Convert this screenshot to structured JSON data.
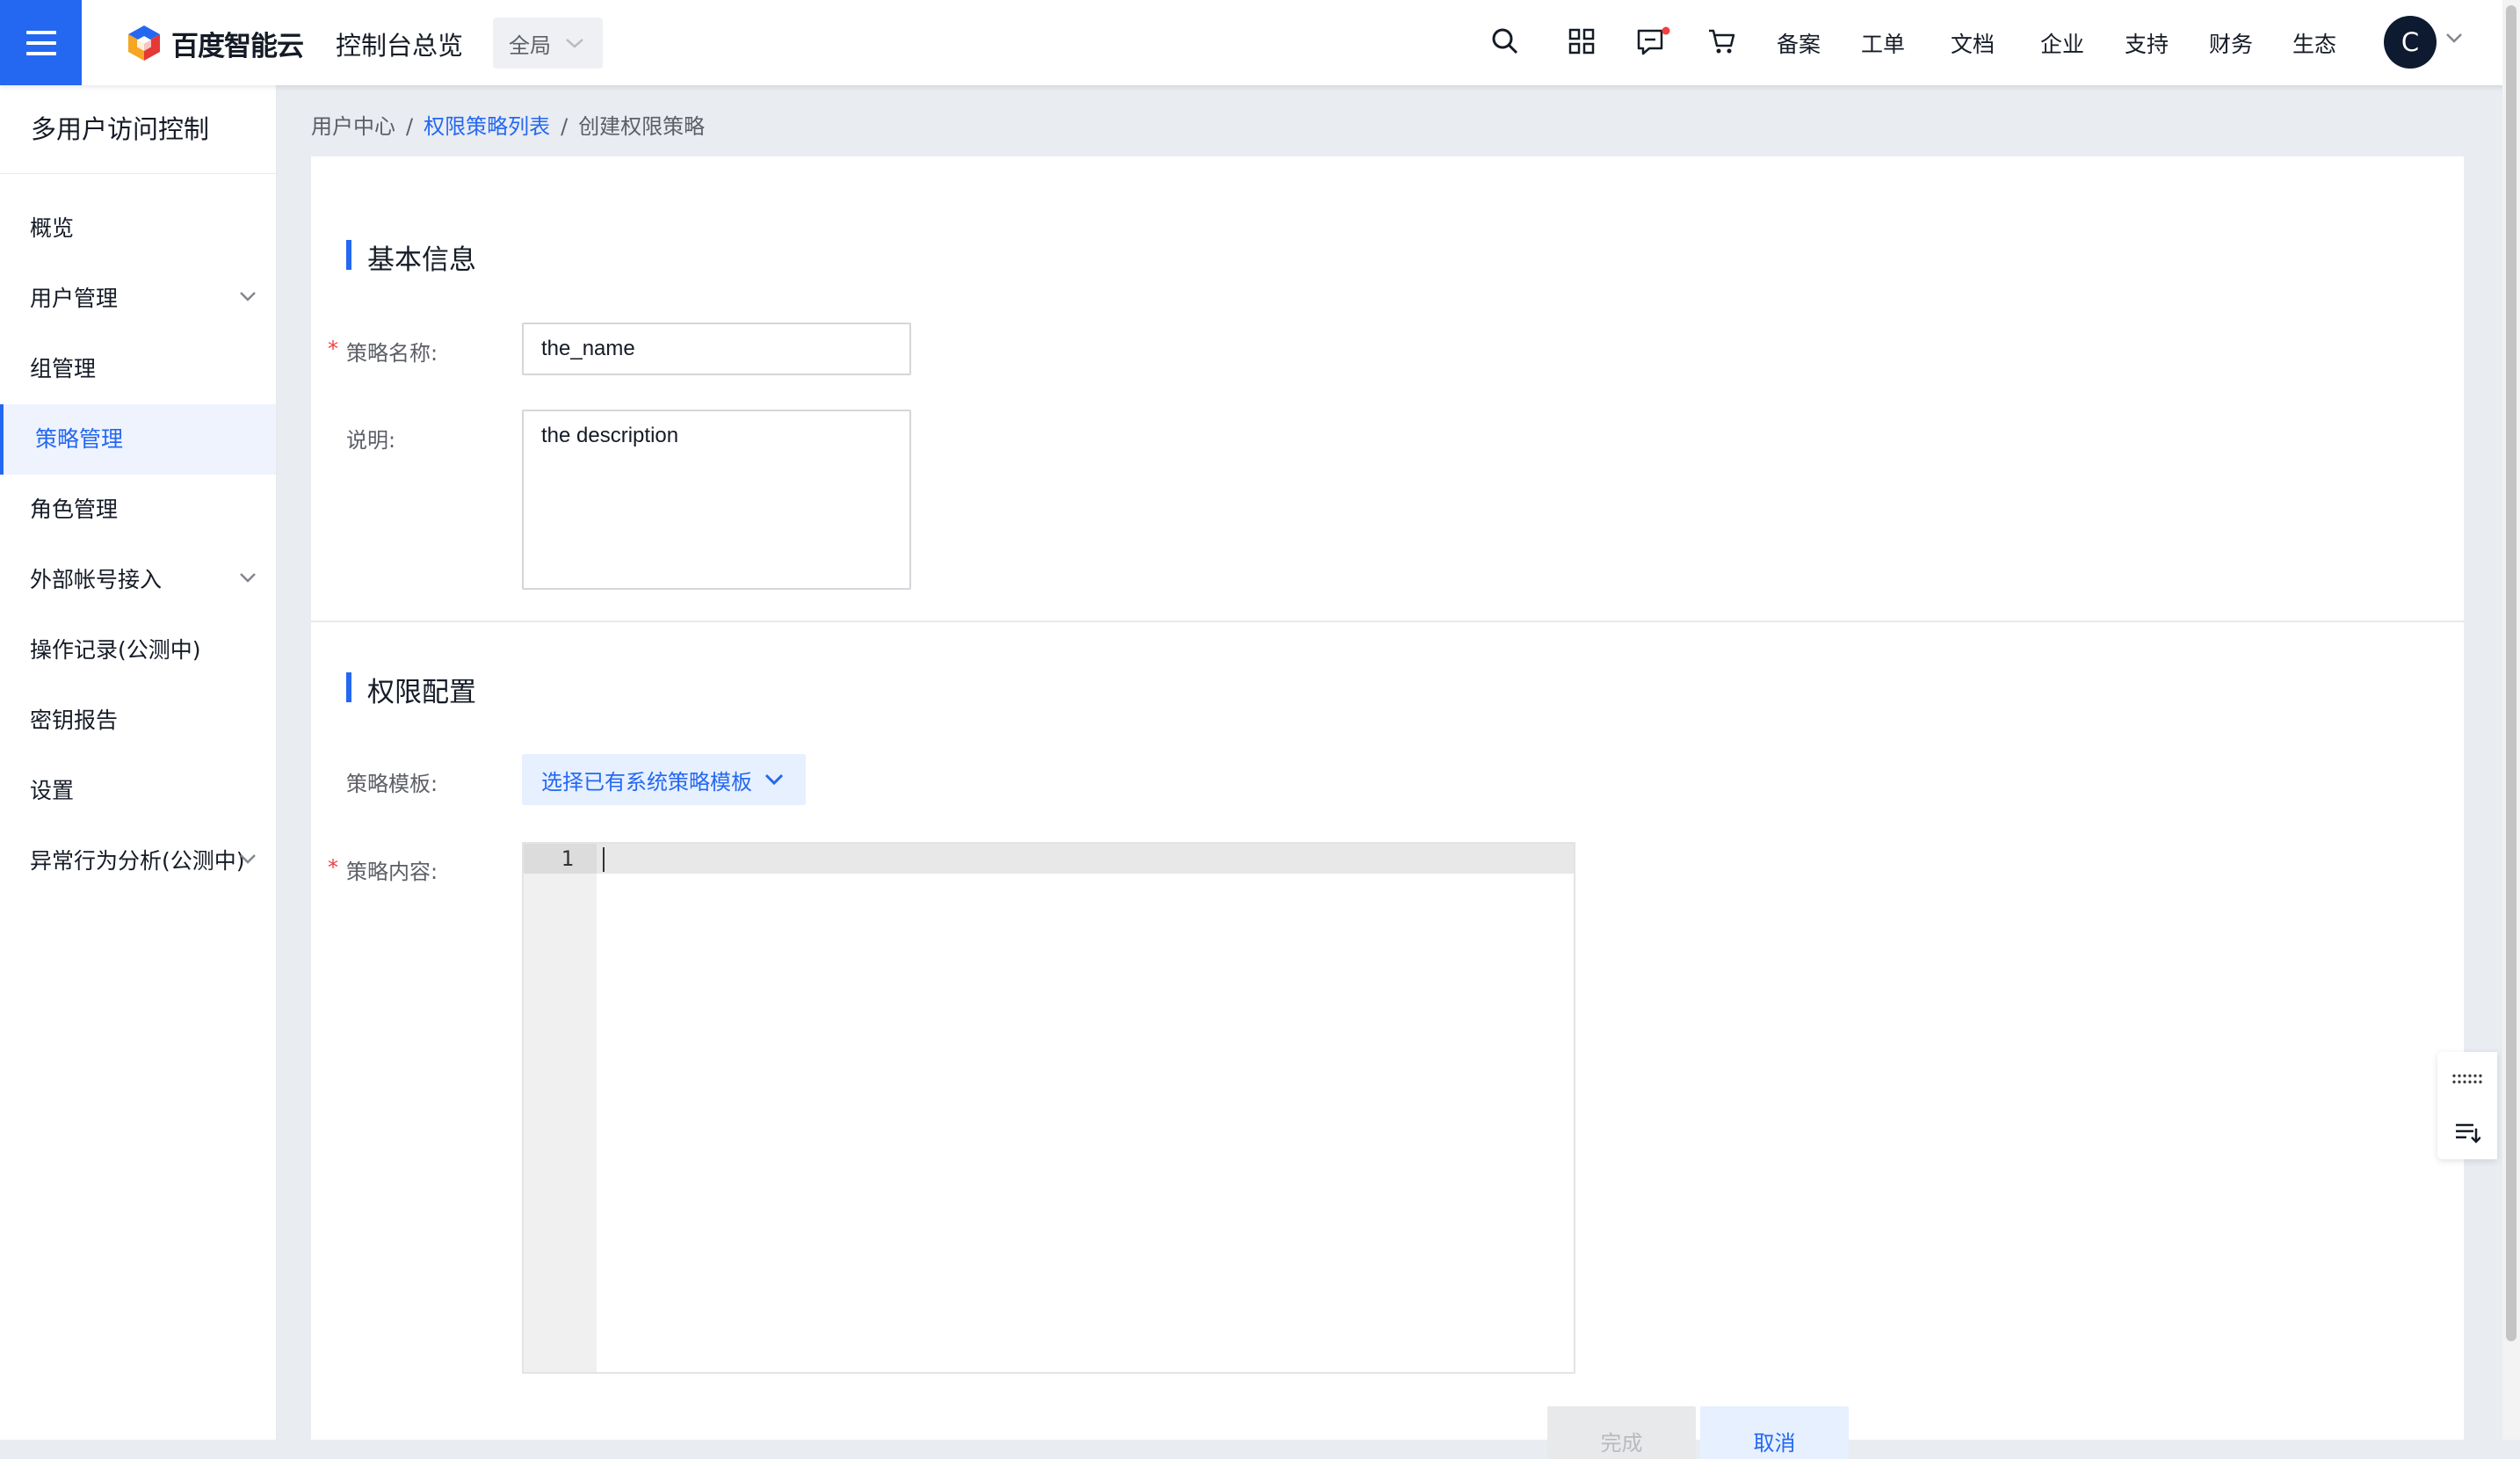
{
  "header": {
    "brand": "百度智能云",
    "console_title": "控制台总览",
    "region": "全局",
    "nav": [
      "备案",
      "工单",
      "文档",
      "企业",
      "支持",
      "财务",
      "生态"
    ],
    "avatar_letter": "C"
  },
  "sidebar": {
    "title": "多用户访问控制",
    "items": [
      {
        "label": "概览"
      },
      {
        "label": "用户管理"
      },
      {
        "label": "组管理"
      },
      {
        "label": "策略管理"
      },
      {
        "label": "角色管理"
      },
      {
        "label": "外部帐号接入"
      },
      {
        "label": "操作记录(公测中)"
      },
      {
        "label": "密钥报告"
      },
      {
        "label": "设置"
      },
      {
        "label": "异常行为分析(公测中)"
      }
    ]
  },
  "breadcrumb": {
    "root": "用户中心",
    "list": "权限策略列表",
    "current": "创建权限策略",
    "separator": "/"
  },
  "basic": {
    "title": "基本信息",
    "name_label": "策略名称:",
    "name_value": "the_name",
    "desc_label": "说明:",
    "desc_value": "the description",
    "required_mark": "*"
  },
  "permission": {
    "title": "权限配置",
    "template_label": "策略模板:",
    "template_button": "选择已有系统策略模板",
    "content_label": "策略内容:",
    "line_number": "1"
  },
  "actions": {
    "done": "完成",
    "cancel": "取消"
  },
  "colors": {
    "accent": "#2468f2",
    "required": "#f33e3e"
  }
}
